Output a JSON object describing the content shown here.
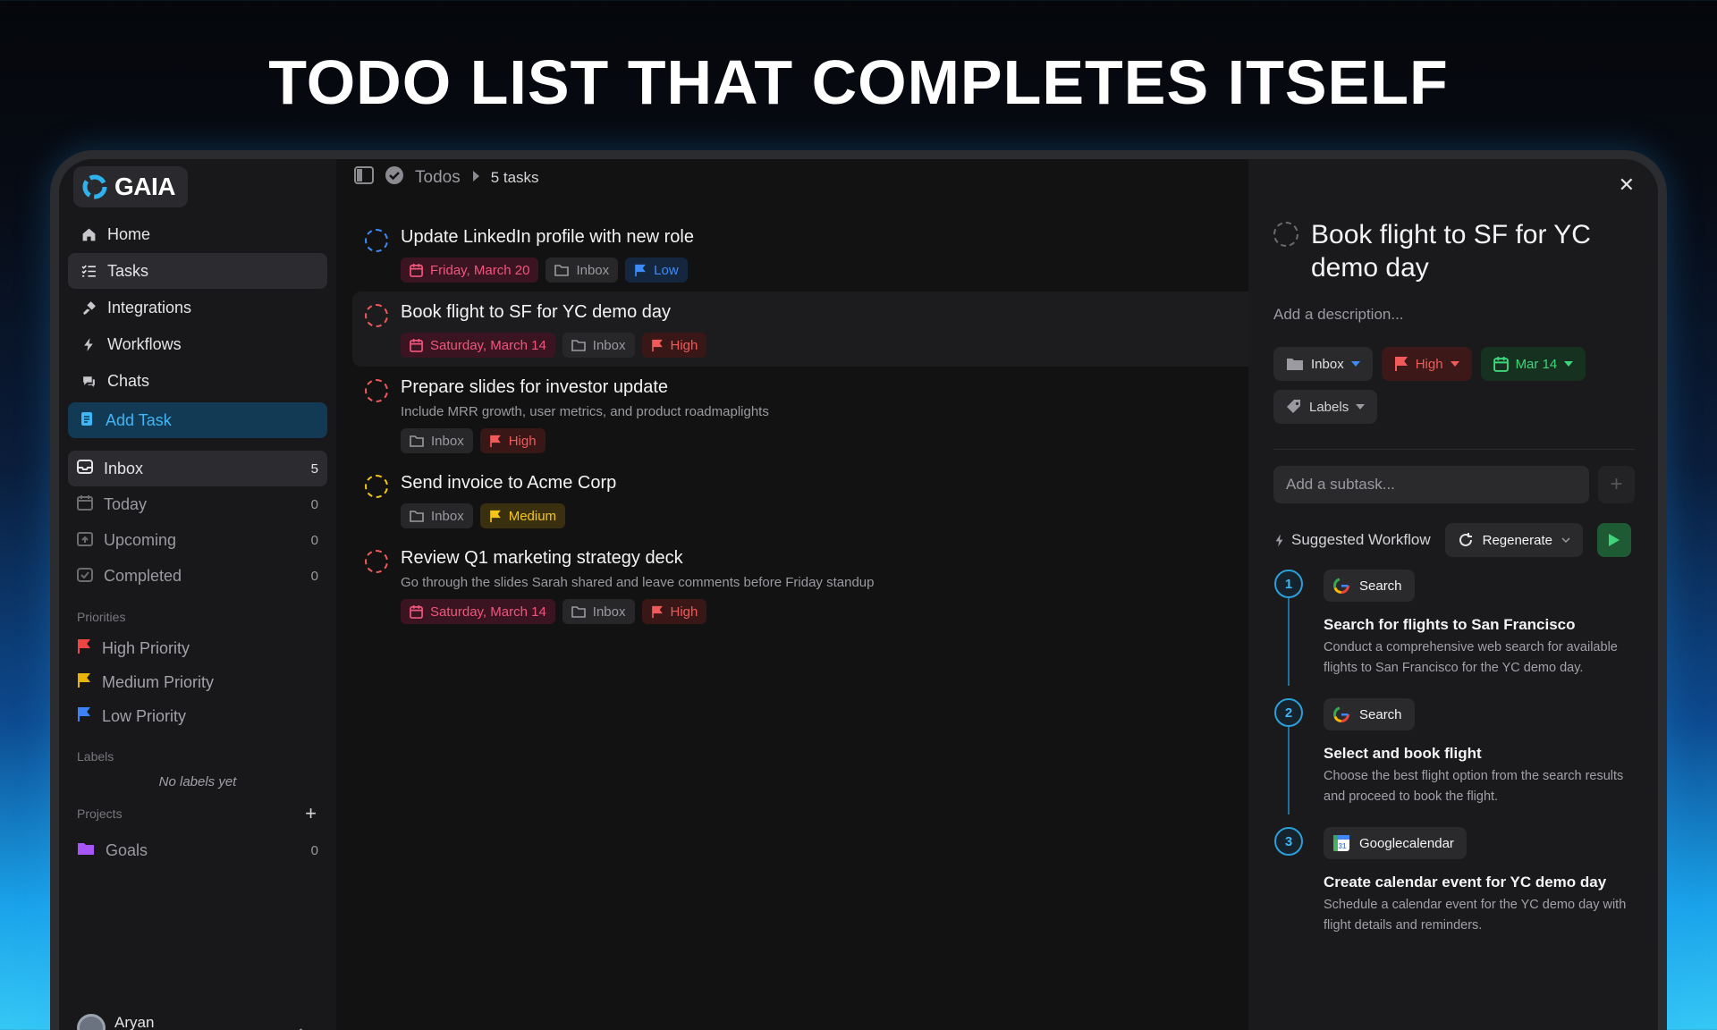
{
  "headline": "TODO LIST THAT COMPLETES ITSELF",
  "app": {
    "logo_text": "GAIA"
  },
  "nav": [
    {
      "label": "Home",
      "icon": "home-icon"
    },
    {
      "label": "Tasks",
      "icon": "tasks-icon"
    },
    {
      "label": "Integrations",
      "icon": "integrations-icon"
    },
    {
      "label": "Workflows",
      "icon": "workflows-icon"
    },
    {
      "label": "Chats",
      "icon": "chats-icon"
    }
  ],
  "add_task_label": "Add Task",
  "lists": [
    {
      "label": "Inbox",
      "count": "5"
    },
    {
      "label": "Today",
      "count": "0"
    },
    {
      "label": "Upcoming",
      "count": "0"
    },
    {
      "label": "Completed",
      "count": "0"
    }
  ],
  "priorities_label": "Priorities",
  "priorities": [
    {
      "label": "High Priority",
      "color": "#ef4444"
    },
    {
      "label": "Medium Priority",
      "color": "#eab308"
    },
    {
      "label": "Low Priority",
      "color": "#3b82f6"
    }
  ],
  "labels_label": "Labels",
  "no_labels": "No labels yet",
  "projects_label": "Projects",
  "projects": [
    {
      "label": "Goals",
      "count": "0"
    }
  ],
  "user": {
    "name": "Aryan"
  },
  "breadcrumb": {
    "section": "Todos",
    "count": "5 tasks"
  },
  "tasks": [
    {
      "title": "Update LinkedIn profile with new role",
      "desc": "",
      "date": "Friday, March 20",
      "project": "Inbox",
      "priority": "Low"
    },
    {
      "title": "Book flight to SF for YC demo day",
      "desc": "",
      "date": "Saturday, March 14",
      "project": "Inbox",
      "priority": "High"
    },
    {
      "title": "Prepare slides for investor update",
      "desc": "Include MRR growth, user metrics, and product roadmaplights",
      "date": "",
      "project": "Inbox",
      "priority": "High"
    },
    {
      "title": "Send invoice to Acme Corp",
      "desc": "",
      "date": "",
      "project": "Inbox",
      "priority": "Medium"
    },
    {
      "title": "Review Q1 marketing strategy deck",
      "desc": "Go through the slides Sarah shared and leave comments before Friday standup",
      "date": "Saturday, March 14",
      "project": "Inbox",
      "priority": "High"
    }
  ],
  "detail": {
    "title": "Book flight to SF for YC demo day",
    "desc_placeholder": "Add a description...",
    "project": "Inbox",
    "priority": "High",
    "date": "Mar 14",
    "labels": "Labels",
    "subtask_placeholder": "Add a subtask...",
    "workflow_label": "Suggested Workflow",
    "regenerate": "Regenerate",
    "steps": [
      {
        "num": "1",
        "tool": "Search",
        "title": "Search for flights to San Francisco",
        "desc": "Conduct a comprehensive web search for available flights to San Francisco for the YC demo day."
      },
      {
        "num": "2",
        "tool": "Search",
        "title": "Select and book flight",
        "desc": "Choose the best flight option from the search results and proceed to book the flight."
      },
      {
        "num": "3",
        "tool": "Googlecalendar",
        "title": "Create calendar event for YC demo day",
        "desc": "Schedule a calendar event for the YC demo day with flight details and reminders."
      }
    ]
  },
  "colors": {
    "accent": "#3fb6f5",
    "high": "#f05a5a",
    "medium": "#f5c518",
    "low": "#3d8bf5",
    "date_red": "#f0567c",
    "date_green": "#3ed67a"
  }
}
